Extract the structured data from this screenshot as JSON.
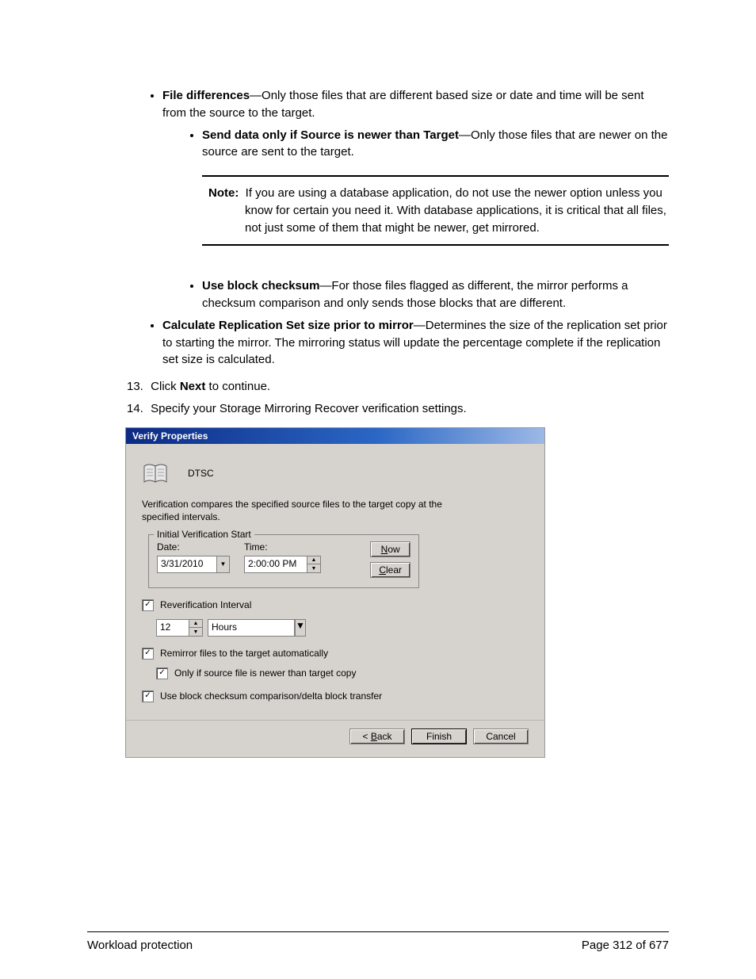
{
  "content": {
    "bullet1_bold": "File differences",
    "bullet1_rest": "—Only those files that are different based size or date and time will be sent from the source to the target.",
    "bullet1a_bold": "Send data only if Source is newer than Target",
    "bullet1a_rest": "—Only those files that are newer on the source are sent to the target.",
    "note_label": "Note:",
    "note_text": "If you are using a database application, do not use the newer option unless you know for certain you need it. With database applications, it is critical that all files, not just some of them that might be newer, get mirrored.",
    "bullet1b_bold": "Use block checksum",
    "bullet1b_rest": "—For those files flagged as different, the mirror performs a checksum comparison and only sends those blocks that are different.",
    "bullet2_bold": "Calculate Replication Set size prior to mirror",
    "bullet2_rest": "—Determines the size of the replication set prior to starting the mirror. The mirroring status will update the percentage complete if the replication set size is calculated.",
    "step13_num": "13.",
    "step13_pre": "Click ",
    "step13_bold": "Next",
    "step13_post": " to continue.",
    "step14_num": "14.",
    "step14_text": "Specify your Storage Mirroring Recover  verification settings."
  },
  "dialog": {
    "title": "Verify Properties",
    "header_label": "DTSC",
    "description": "Verification compares the specified source files to the target copy at the specified intervals.",
    "fieldset_legend": "Initial Verification Start",
    "date_label": "Date:",
    "time_label": "Time:",
    "date_value": "3/31/2010",
    "time_value": "2:00:00 PM",
    "now_btn": "Now",
    "clear_btn": "Clear",
    "reverify_label": "Reverification Interval",
    "interval_value": "12",
    "interval_unit": "Hours",
    "remirror_label": "Remirror files to the target automatically",
    "only_if_label": "Only if source file is newer than target copy",
    "checksum_label": "Use block checksum comparison/delta block transfer",
    "back_btn": "< Back",
    "finish_btn": "Finish",
    "cancel_btn": "Cancel",
    "now_u": "N",
    "clear_u": "C",
    "back_u": "B"
  },
  "footer": {
    "left": "Workload protection",
    "right": "Page 312 of 677"
  }
}
